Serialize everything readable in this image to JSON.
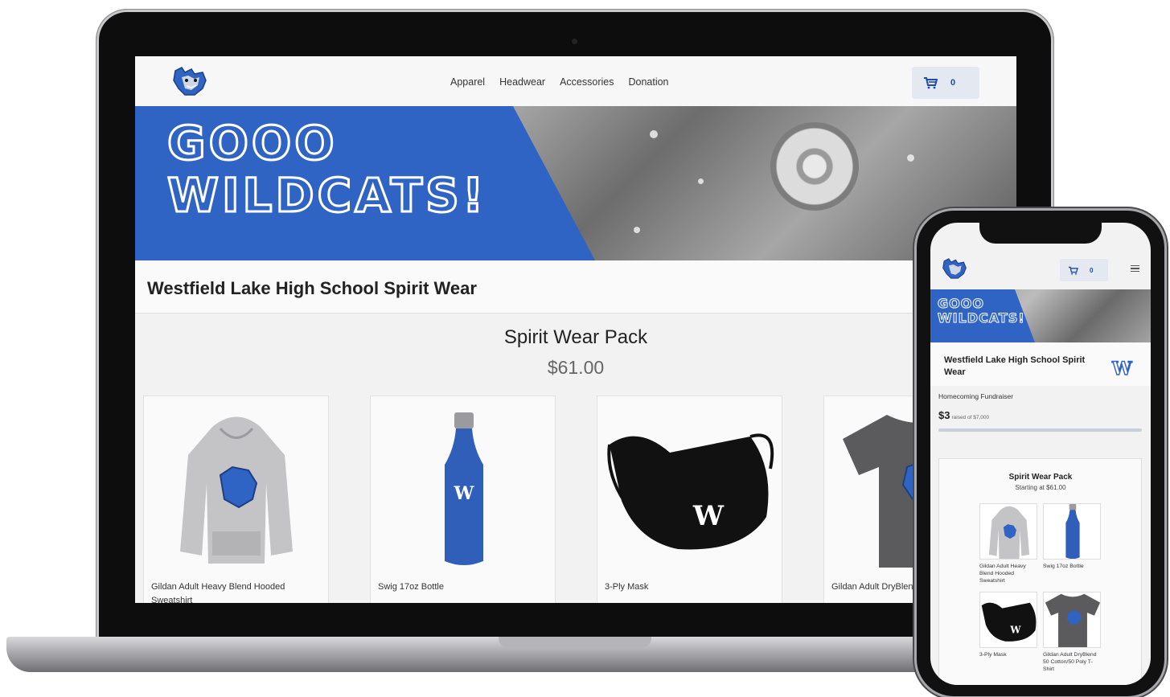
{
  "desktop": {
    "nav": {
      "items": [
        "Apparel",
        "Headwear",
        "Accessories",
        "Donation"
      ]
    },
    "cart": {
      "count": "0"
    },
    "hero": {
      "line1": "GOOO",
      "line2": "WILDCATS!"
    },
    "store_title": "Westfield Lake High School Spirit Wear",
    "pack": {
      "title": "Spirit Wear Pack",
      "price": "$61.00"
    },
    "products": [
      {
        "name": "Gildan Adult Heavy Blend Hooded Sweatshirt"
      },
      {
        "name": "Swig 17oz Bottle"
      },
      {
        "name": "3-Ply Mask"
      },
      {
        "name": "Gildan Adult DryBlend T-Shirt"
      }
    ]
  },
  "mobile": {
    "cart": {
      "count": "0"
    },
    "hero": {
      "line1": "GOOO",
      "line2": "WILDCATS!"
    },
    "store_title": "Westfield Lake High School Spirit Wear",
    "w_logo": "W",
    "fundraiser": {
      "label": "Homecoming Fundraiser",
      "raised": "$3",
      "goal_text": "raised of $7,000",
      "progress_fraction": 0.0004
    },
    "pack": {
      "title": "Spirit Wear Pack",
      "price": "Starting at $61.00"
    },
    "products": [
      {
        "name": "Gildan Adult Heavy Blend Hooded Sweatshirt"
      },
      {
        "name": "Swig 17oz Bottle"
      },
      {
        "name": "3-Ply Mask"
      },
      {
        "name": "Gildan Adult DryBlend 50 Cotton/50 Poly T-Shirt"
      }
    ]
  },
  "colors": {
    "brand_blue": "#2f63c4",
    "cart_bg": "#e4e8f0"
  }
}
